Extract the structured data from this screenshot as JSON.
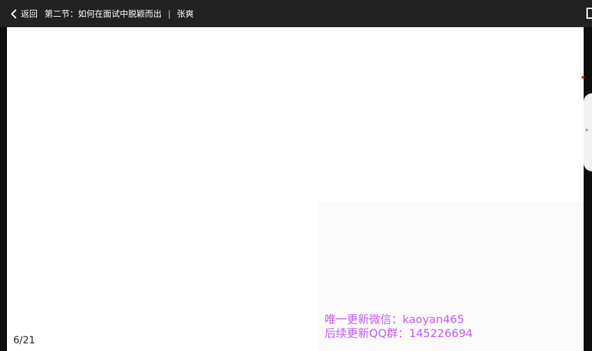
{
  "header": {
    "back_label": "返回",
    "lesson_title": "第二节：如何在面试中脱颖而出",
    "divider": "|",
    "teacher": "张爽"
  },
  "slide": {
    "page_indicator": "6/21",
    "watermark_line1": "唯一更新微信：kaoyan465",
    "watermark_line2": "后续更新QQ群：145226694"
  },
  "side_panel": {
    "toggle_glyph": "▸"
  },
  "colors": {
    "header_bg": "#222222",
    "watermark": "#c35bf2",
    "marker": "#e0201c"
  },
  "icons": {
    "back": "chevron-left-icon",
    "window": "window-icon",
    "panel_toggle": "chevron-right-icon"
  }
}
